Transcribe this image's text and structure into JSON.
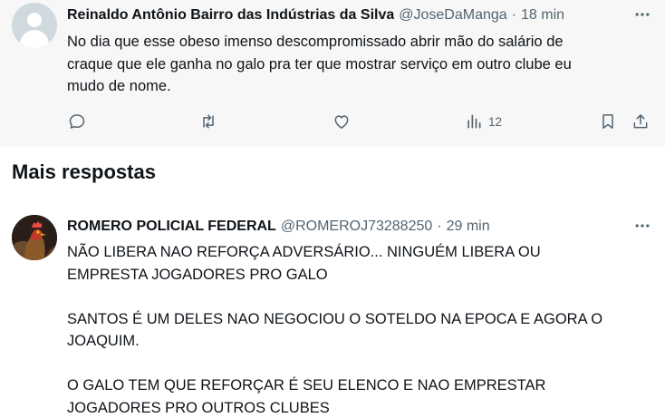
{
  "tweet1": {
    "author_name": "Reinaldo Antônio Bairro das Indústrias da Silva",
    "handle": "@JoseDaManga",
    "separator": "·",
    "time": "18 min",
    "text": "No dia que esse obeso imenso descompromissado abrir mão do salário de\ncraque que ele ganha no galo pra ter que mostrar serviço em outro clube eu\nmudo de nome.",
    "actions": {
      "reply": {
        "icon": "reply-icon",
        "count": ""
      },
      "retweet": {
        "icon": "retweet-icon",
        "count": ""
      },
      "like": {
        "icon": "like-icon",
        "count": ""
      },
      "views": {
        "icon": "views-icon",
        "count": "12"
      },
      "bookmark": {
        "icon": "bookmark-icon"
      },
      "share": {
        "icon": "share-icon"
      }
    }
  },
  "section": {
    "title": "Mais respostas"
  },
  "tweet2": {
    "author_name": "ROMERO POLICIAL FEDERAL",
    "handle": "@ROMEROJ73288250",
    "separator": "·",
    "time": "29 min",
    "text": "NÃO LIBERA NAO REFORÇA ADVERSÁRIO... NINGUÉM LIBERA OU\nEMPRESTA JOGADORES PRO GALO\n\nSANTOS É UM DELES NAO NEGOCIOU O SOTELDO NA EPOCA E AGORA O\nJOAQUIM.\n\nO GALO TEM QUE REFORÇAR É SEU ELENCO E NAO EMPRESTAR\nJOGADORES PRO OUTROS CLUBES"
  },
  "colors": {
    "text_primary": "#0f1419",
    "text_secondary": "#536471",
    "highlight_bg": "#f7f7f7"
  }
}
